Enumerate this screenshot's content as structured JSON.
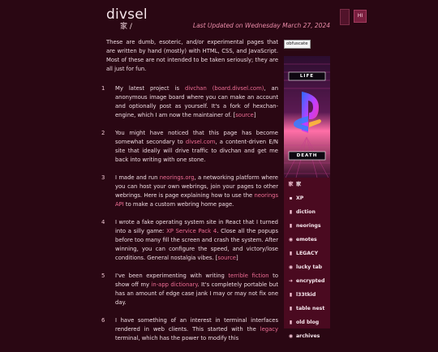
{
  "header": {
    "site_title": "divsel",
    "breadcrumb": "家 /",
    "last_updated": "Last Updated on Wednesday March 27, 2024",
    "corner_button": "HI"
  },
  "intro": "These are dumb, esoteric, and/or experimental pages that are written by hand (mostly) with HTML, CSS, and JavaScript. Most of these are not intended to be taken seriously; they are all just for fun.",
  "items": [
    {
      "num": "1",
      "t1": "My latest project is ",
      "l1": "divchan (board.divsel.com)",
      "t2": ", an anonymous image board where you can make an account and optionally post as yourself. It's a fork of hexchan-engine, which I am now the maintainer of. [",
      "l2": "source",
      "t3": "]"
    },
    {
      "num": "2",
      "t1": "You might have noticed that this page has become somewhat secondary to ",
      "l1": "divsel.com",
      "t2": ", a content-driven E/N site that ideally will drive traffic to divchan and get me back into writing with one stone."
    },
    {
      "num": "3",
      "t1": "I made and run ",
      "l1": "neorings.org",
      "t2": ", a networking platform where you can host your own webrings, join your pages to other webrings. Here is page explaining how to use the ",
      "l2": "neorings API",
      "t3": " to make a custom webring home page."
    },
    {
      "num": "4",
      "t1": "I wrote a fake operating system site in React that I turned into a silly game: ",
      "l1": "XP Service Pack 4",
      "t2": ". Close all the popups before too many fill the screen and crash the system. After winning, you can configure the speed, and victory/lose conditions. General nostalgia vibes. [",
      "l2": "source",
      "t3": "]"
    },
    {
      "num": "5",
      "t1": "I've been experimenting with writing ",
      "l1": "terrible fiction",
      "t2": " to show off my ",
      "l2": "in-app dictionary",
      "t3": ". It's completely portable but has an amount of edge case jank I may or may not fix one day."
    },
    {
      "num": "6",
      "t1": "I have something of an interest in terminal interfaces rendered in web clients. This started with the ",
      "l1": "legacy",
      "t2": " terminal, which has the power to modify this"
    }
  ],
  "sidebar": {
    "obfuscate_label": "obfuscate",
    "hero_top_text": "LIFE",
    "hero_bottom_text": "DEATH",
    "nav": [
      {
        "icon": "house-icon",
        "glyph": "家",
        "label": "家"
      },
      {
        "icon": "xp-icon",
        "glyph": "▪",
        "label": "XP"
      },
      {
        "icon": "dict-icon",
        "glyph": "▮",
        "label": "diction"
      },
      {
        "icon": "ring-icon",
        "glyph": "▮",
        "label": "neorings"
      },
      {
        "icon": "emote-icon",
        "glyph": "◉",
        "label": "emotes"
      },
      {
        "icon": "legacy-icon",
        "glyph": "▮",
        "label": "LEGACY"
      },
      {
        "icon": "lucky-icon",
        "glyph": "◉",
        "label": "lucky tab"
      },
      {
        "icon": "encrypted-icon",
        "glyph": "➜",
        "label": "encrypted"
      },
      {
        "icon": "1337-icon",
        "glyph": "▮",
        "label": "l33tkid"
      },
      {
        "icon": "table-icon",
        "glyph": "▮",
        "label": "table nest"
      },
      {
        "icon": "blog-icon",
        "glyph": "▮",
        "label": "old blog"
      },
      {
        "icon": "archive-icon",
        "glyph": "◉",
        "label": "archives"
      }
    ]
  }
}
